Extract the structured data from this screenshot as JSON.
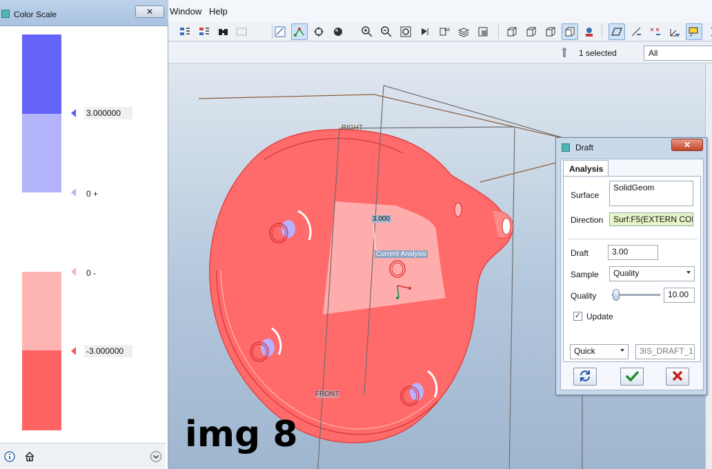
{
  "menu": {
    "window_label": "Window",
    "help_label": "Help"
  },
  "status": {
    "selection_text": "1 selected",
    "filter_value": "All"
  },
  "color_scale": {
    "title": "Color Scale",
    "close_label": "✕",
    "bands": [
      "#6464f8",
      "#b4b4fb",
      "#ffffff",
      "#ffb4b4",
      "#ff6464"
    ],
    "ticks": [
      {
        "label": "3.000000",
        "boxed": true,
        "marker_color": "#5b5ef0"
      },
      {
        "label": "0 +",
        "boxed": false,
        "marker_color": "#b7b7f6"
      },
      {
        "label": "0 -",
        "boxed": false,
        "marker_color": "#f4b3b3"
      },
      {
        "label": "-3.000000",
        "boxed": true,
        "marker_color": "#f05a5a"
      }
    ]
  },
  "viewport": {
    "plane_right": "RIGHT",
    "plane_front": "FRONT",
    "annotation_value": "3.000",
    "annotation_label": "Current Analysis",
    "image_caption": "img 8"
  },
  "draft_dialog": {
    "title": "Draft",
    "close_label": "✕",
    "tab_label": "Analysis",
    "surface_label": "Surface",
    "surface_value": "SolidGeom",
    "direction_label": "Direction",
    "direction_value": "Surf:F5(EXTERN COP",
    "draft_label": "Draft",
    "draft_value": "3.00",
    "sample_label": "Sample",
    "sample_value": "Quality",
    "quality_label": "Quality",
    "quality_value": "10.00",
    "update_label": "Update",
    "update_checked": "✓",
    "mode_value": "Quick",
    "name_value": "3IS_DRAFT_1"
  }
}
